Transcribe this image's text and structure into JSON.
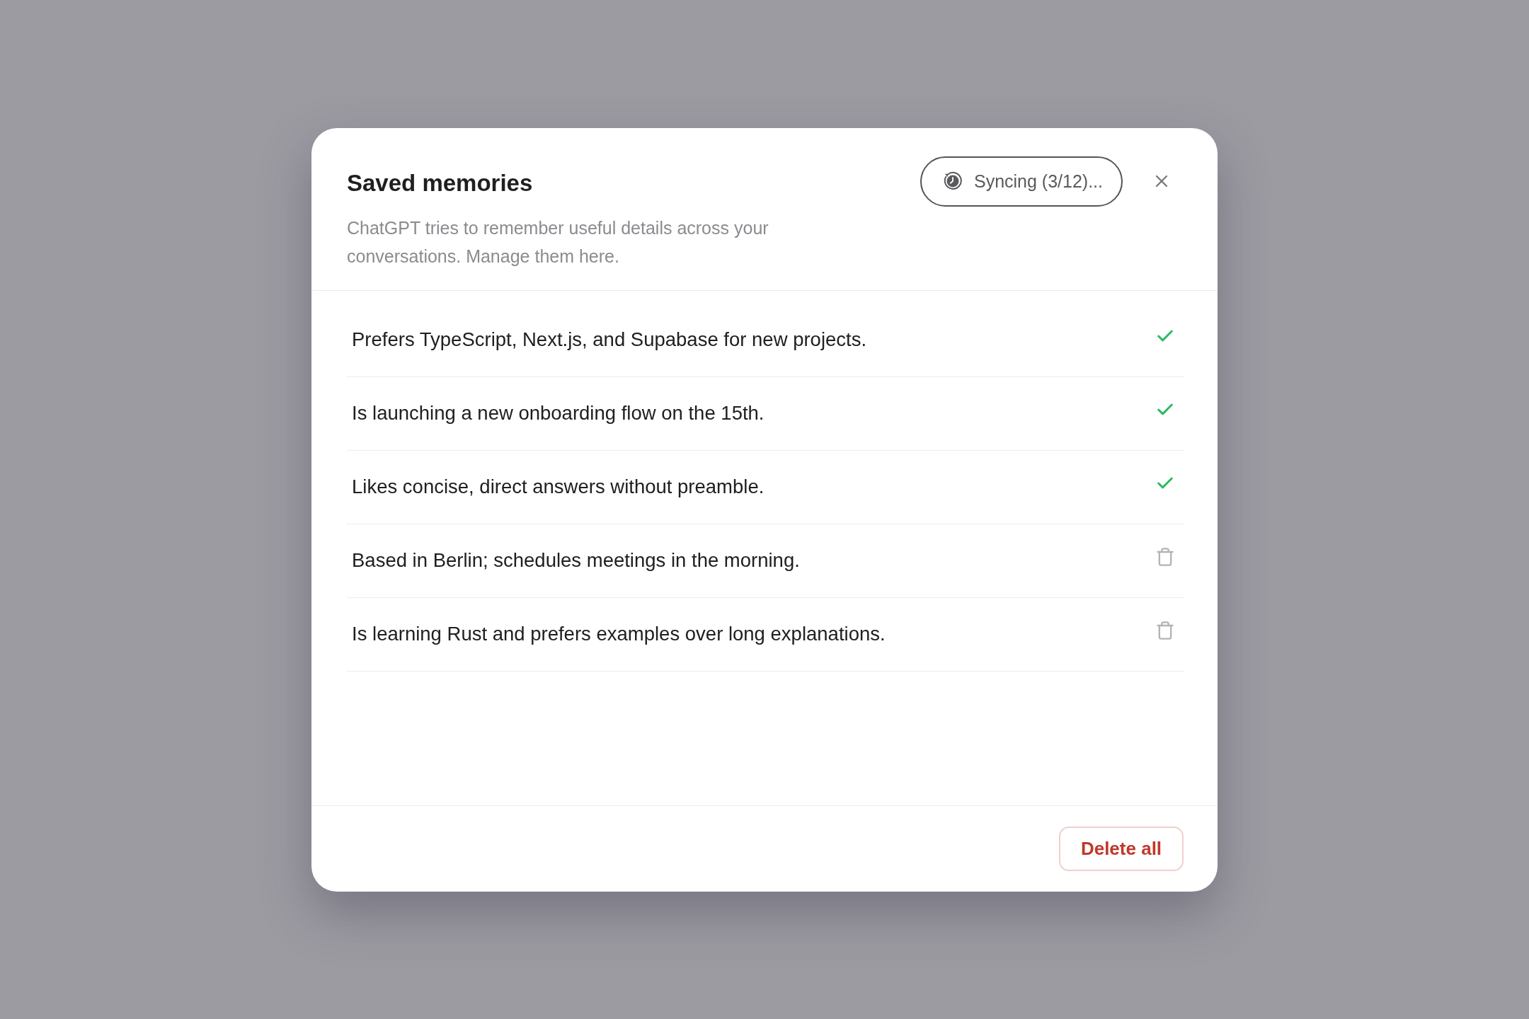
{
  "dialog": {
    "title": "Saved memories",
    "description": "ChatGPT tries to remember useful details across your conversations. Manage them here.",
    "sync_button": {
      "label": "Syncing (3/12)..."
    },
    "memories": [
      {
        "text": "Prefers TypeScript, Next.js, and Supabase for new projects.",
        "synced": true
      },
      {
        "text": "Is launching a new onboarding flow on the 15th.",
        "synced": true
      },
      {
        "text": "Likes concise, direct answers without preamble.",
        "synced": true
      },
      {
        "text": "Based in Berlin; schedules meetings in the morning.",
        "synced": false
      },
      {
        "text": "Is learning Rust and prefers examples over long explanations.",
        "synced": false
      }
    ],
    "footer": {
      "delete_button": "Delete all"
    }
  }
}
